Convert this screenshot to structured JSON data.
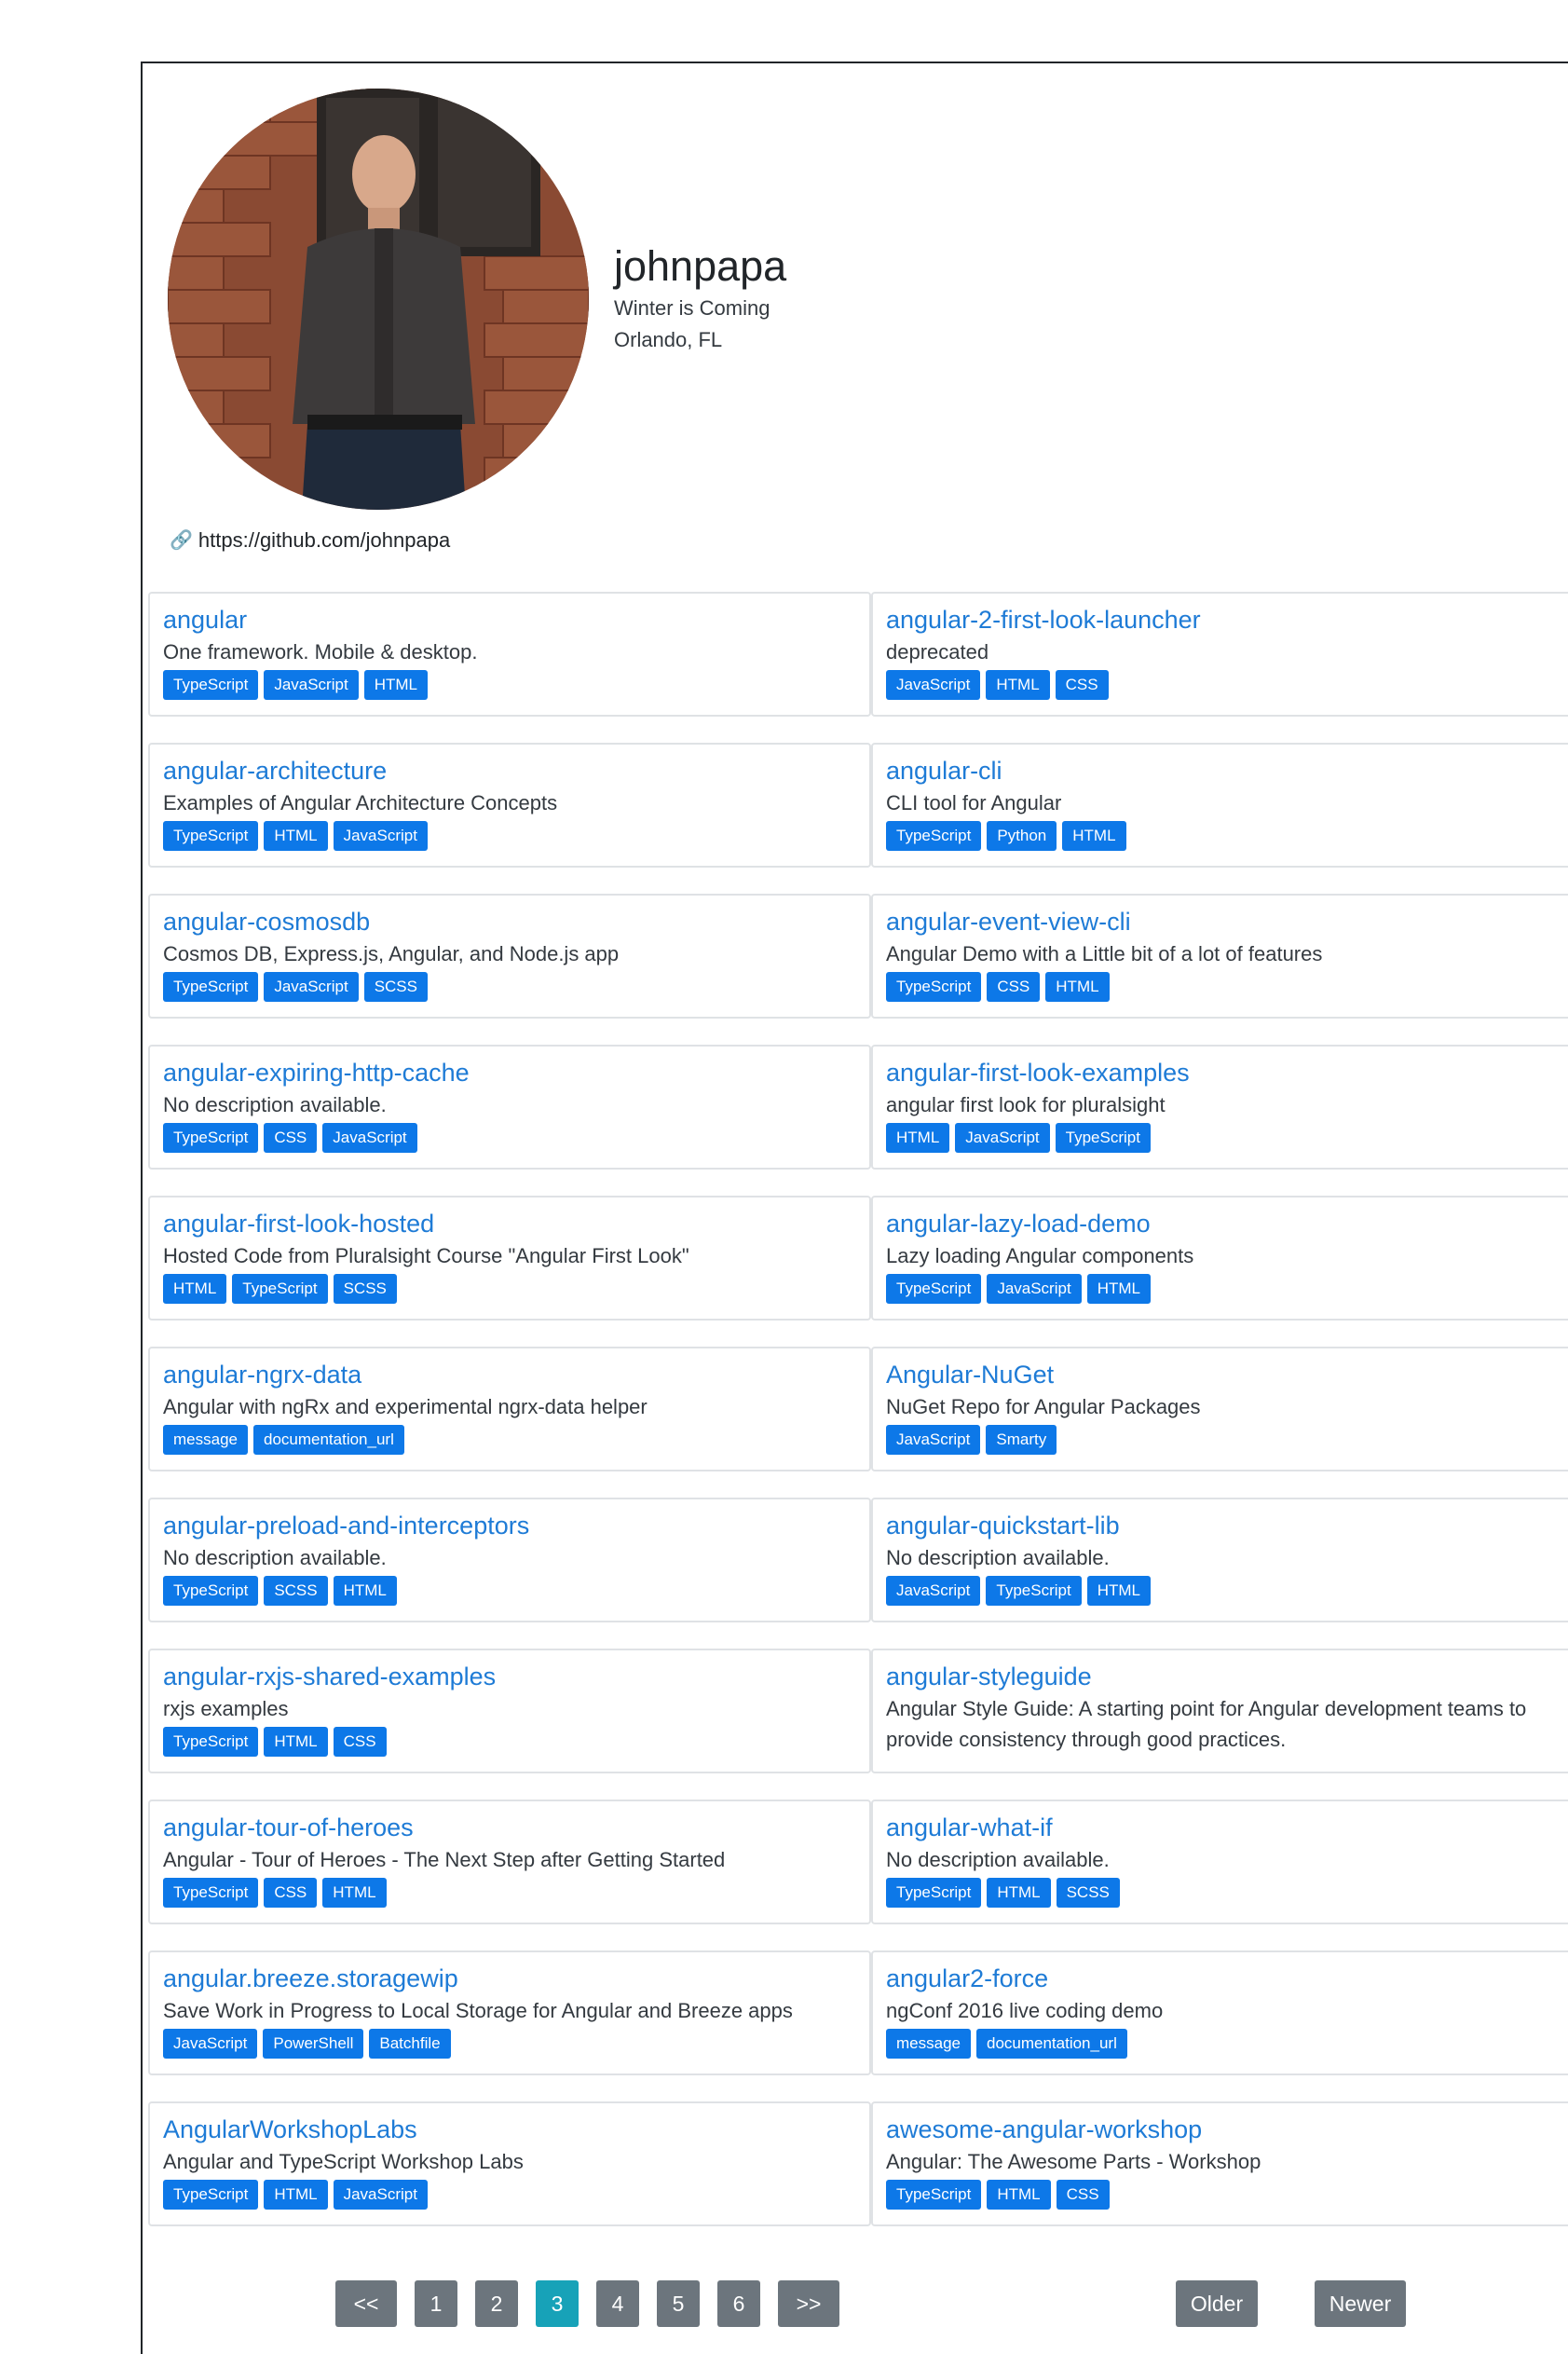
{
  "profile": {
    "name": "johnpapa",
    "bio": "Winter is Coming",
    "location": "Orlando, FL",
    "blog_url": "https://github.com/johnpapa",
    "link_icon": "link-icon"
  },
  "repos": [
    {
      "name": "angular",
      "description": "One framework. Mobile & desktop.",
      "tags": [
        "TypeScript",
        "JavaScript",
        "HTML"
      ]
    },
    {
      "name": "angular-2-first-look-launcher",
      "description": "deprecated",
      "tags": [
        "JavaScript",
        "HTML",
        "CSS"
      ]
    },
    {
      "name": "angular-architecture",
      "description": "Examples of Angular Architecture Concepts",
      "tags": [
        "TypeScript",
        "HTML",
        "JavaScript"
      ]
    },
    {
      "name": "angular-cli",
      "description": "CLI tool for Angular",
      "tags": [
        "TypeScript",
        "Python",
        "HTML"
      ]
    },
    {
      "name": "angular-cosmosdb",
      "description": "Cosmos DB, Express.js, Angular, and Node.js app",
      "tags": [
        "TypeScript",
        "JavaScript",
        "SCSS"
      ]
    },
    {
      "name": "angular-event-view-cli",
      "description": "Angular Demo with a Little bit of a lot of features",
      "tags": [
        "TypeScript",
        "CSS",
        "HTML"
      ]
    },
    {
      "name": "angular-expiring-http-cache",
      "description": "No description available.",
      "tags": [
        "TypeScript",
        "CSS",
        "JavaScript"
      ]
    },
    {
      "name": "angular-first-look-examples",
      "description": "angular first look for pluralsight",
      "tags": [
        "HTML",
        "JavaScript",
        "TypeScript"
      ]
    },
    {
      "name": "angular-first-look-hosted",
      "description": "Hosted Code from Pluralsight Course \"Angular First Look\"",
      "tags": [
        "HTML",
        "TypeScript",
        "SCSS"
      ]
    },
    {
      "name": "angular-lazy-load-demo",
      "description": "Lazy loading Angular components",
      "tags": [
        "TypeScript",
        "JavaScript",
        "HTML"
      ]
    },
    {
      "name": "angular-ngrx-data",
      "description": "Angular with ngRx and experimental ngrx-data helper",
      "tags": [
        "message",
        "documentation_url"
      ]
    },
    {
      "name": "Angular-NuGet",
      "description": "NuGet Repo for Angular Packages",
      "tags": [
        "JavaScript",
        "Smarty"
      ]
    },
    {
      "name": "angular-preload-and-interceptors",
      "description": "No description available.",
      "tags": [
        "TypeScript",
        "SCSS",
        "HTML"
      ]
    },
    {
      "name": "angular-quickstart-lib",
      "description": "No description available.",
      "tags": [
        "JavaScript",
        "TypeScript",
        "HTML"
      ]
    },
    {
      "name": "angular-rxjs-shared-examples",
      "description": "rxjs examples",
      "tags": [
        "TypeScript",
        "HTML",
        "CSS"
      ]
    },
    {
      "name": "angular-styleguide",
      "description": "Angular Style Guide: A starting point for Angular development teams to provide consistency through good practices.",
      "tags": []
    },
    {
      "name": "angular-tour-of-heroes",
      "description": "Angular - Tour of Heroes - The Next Step after Getting Started",
      "tags": [
        "TypeScript",
        "CSS",
        "HTML"
      ]
    },
    {
      "name": "angular-what-if",
      "description": "No description available.",
      "tags": [
        "TypeScript",
        "HTML",
        "SCSS"
      ]
    },
    {
      "name": "angular.breeze.storagewip",
      "description": "Save Work in Progress to Local Storage for Angular and Breeze apps",
      "tags": [
        "JavaScript",
        "PowerShell",
        "Batchfile"
      ]
    },
    {
      "name": "angular2-force",
      "description": "ngConf 2016 live coding demo",
      "tags": [
        "message",
        "documentation_url"
      ]
    },
    {
      "name": "AngularWorkshopLabs",
      "description": "Angular and TypeScript Workshop Labs",
      "tags": [
        "TypeScript",
        "HTML",
        "JavaScript"
      ]
    },
    {
      "name": "awesome-angular-workshop",
      "description": "Angular: The Awesome Parts - Workshop",
      "tags": [
        "TypeScript",
        "HTML",
        "CSS"
      ]
    }
  ],
  "pagination": {
    "first": "<<",
    "last": ">>",
    "pages": [
      "1",
      "2",
      "3",
      "4",
      "5",
      "6"
    ],
    "current": "3",
    "older": "Older",
    "newer": "Newer"
  },
  "colors": {
    "link": "#1e7bd6",
    "tag": "#0d78e8",
    "pager": "#6c757d",
    "pager_active": "#17a2b8"
  }
}
